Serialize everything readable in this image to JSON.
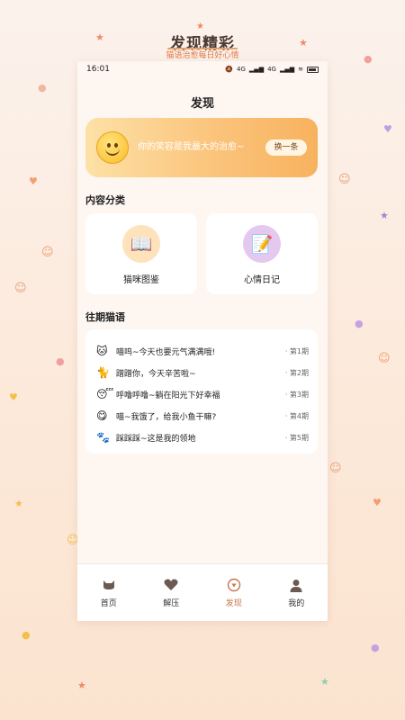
{
  "promo": {
    "title": "发现精彩",
    "subtitle": "猫语治愈每日好心情"
  },
  "status_bar": {
    "time": "16:01",
    "network_1": "4G",
    "network_2": "4G"
  },
  "header": {
    "title": "发现"
  },
  "quote_card": {
    "text": "你的笑容是我最大的治愈~",
    "button_label": "换一条",
    "icon": "smiley-face-icon"
  },
  "categories": {
    "title": "内容分类",
    "items": [
      {
        "label": "猫咪图鉴",
        "icon": "book-icon",
        "icon_bg": "#fde2bb"
      },
      {
        "label": "心情日记",
        "icon": "memo-icon",
        "icon_bg": "#e5c8ef"
      }
    ]
  },
  "past_messages": {
    "title": "往期猫语",
    "items": [
      {
        "icon": "cat-face-icon",
        "glyph": "🐱",
        "text": "喵呜~今天也要元气满满哦!",
        "episode": "· 第1期"
      },
      {
        "icon": "cat-icon",
        "glyph": "🐈",
        "text": "蹭蹭你，今天辛苦啦~",
        "episode": "· 第2期"
      },
      {
        "icon": "sleepy-face-icon",
        "glyph": "😴",
        "text": "呼噜呼噜~躺在阳光下好幸福",
        "episode": "· 第3期"
      },
      {
        "icon": "yummy-face-icon",
        "glyph": "😋",
        "text": "喵~我饿了，给我小鱼干嘛?",
        "episode": "· 第4期"
      },
      {
        "icon": "paw-prints-icon",
        "glyph": "🐾",
        "text": "踩踩踩~这是我的领地",
        "episode": "· 第5期"
      }
    ]
  },
  "tabbar": {
    "active_color": "#c8754a",
    "items": [
      {
        "label": "首页",
        "icon": "cat-head-icon"
      },
      {
        "label": "解压",
        "icon": "heart-icon"
      },
      {
        "label": "发现",
        "icon": "discover-icon"
      },
      {
        "label": "我的",
        "icon": "person-icon"
      }
    ]
  }
}
